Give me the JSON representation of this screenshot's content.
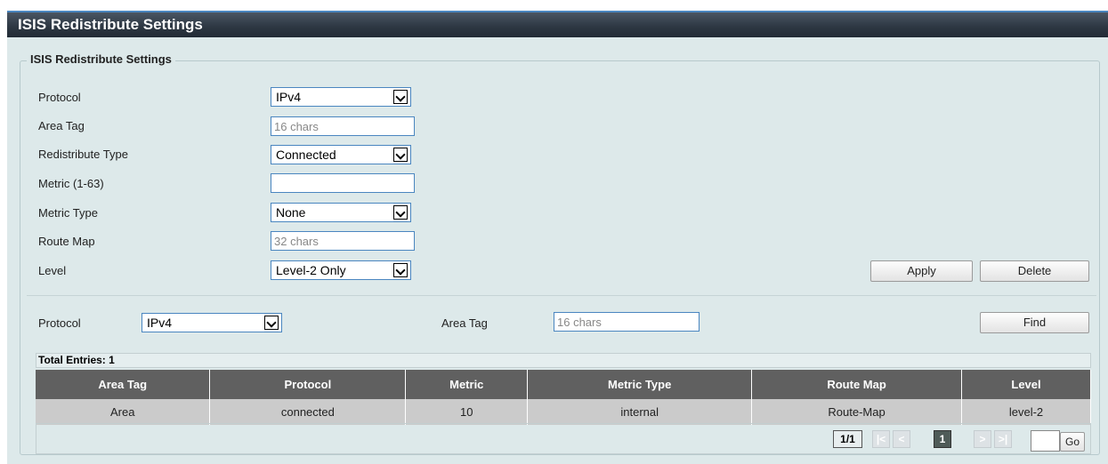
{
  "page": {
    "title": "ISIS Redistribute Settings"
  },
  "form": {
    "legend": "ISIS Redistribute Settings",
    "protocol": {
      "label": "Protocol",
      "value": "IPv4"
    },
    "area_tag": {
      "label": "Area Tag",
      "placeholder": "16 chars"
    },
    "redistribute_type": {
      "label": "Redistribute Type",
      "value": "Connected"
    },
    "metric": {
      "label": "Metric (1-63)",
      "value": ""
    },
    "metric_type": {
      "label": "Metric Type",
      "value": "None"
    },
    "route_map": {
      "label": "Route Map",
      "placeholder": "32 chars"
    },
    "level": {
      "label": "Level",
      "value": "Level-2 Only"
    },
    "apply_label": "Apply",
    "delete_label": "Delete"
  },
  "filter": {
    "protocol_label": "Protocol",
    "protocol_value": "IPv4",
    "area_tag_label": "Area Tag",
    "area_tag_placeholder": "16 chars",
    "find_label": "Find"
  },
  "table": {
    "total_entries": "Total Entries: 1",
    "columns": [
      "Area Tag",
      "Protocol",
      "Metric",
      "Metric Type",
      "Route Map",
      "Level"
    ],
    "rows": [
      [
        "Area",
        "connected",
        "10",
        "internal",
        "Route-Map",
        "level-2"
      ]
    ]
  },
  "pagination": {
    "page_info": "1/1",
    "first": "|<",
    "prev": "<",
    "current": "1",
    "next": ">",
    "last": ">|",
    "go_label": "Go"
  }
}
